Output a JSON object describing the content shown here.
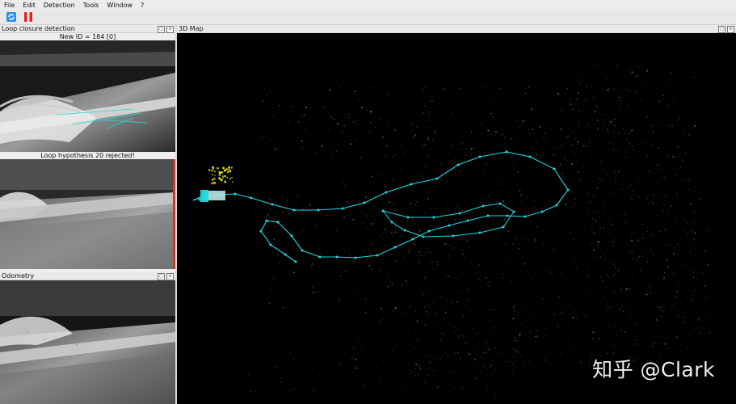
{
  "menu": [
    "File",
    "Edit",
    "Detection",
    "Tools",
    "Window",
    "?"
  ],
  "toolbar": {
    "refresh_icon": "refresh-icon",
    "pause_icon": "pause-icon"
  },
  "panels": {
    "loop": {
      "title": "Loop closure detection",
      "caption_top": "New ID = 184 [0]",
      "caption_mid": "Loop hypothesis 20 rejected!"
    },
    "odometry": {
      "title": "Odometry"
    },
    "map": {
      "title": "3D Map",
      "watermark": "知乎 @Clark"
    }
  },
  "colors": {
    "trajectory": "#21d8df",
    "highlight": "#f5f52a"
  }
}
